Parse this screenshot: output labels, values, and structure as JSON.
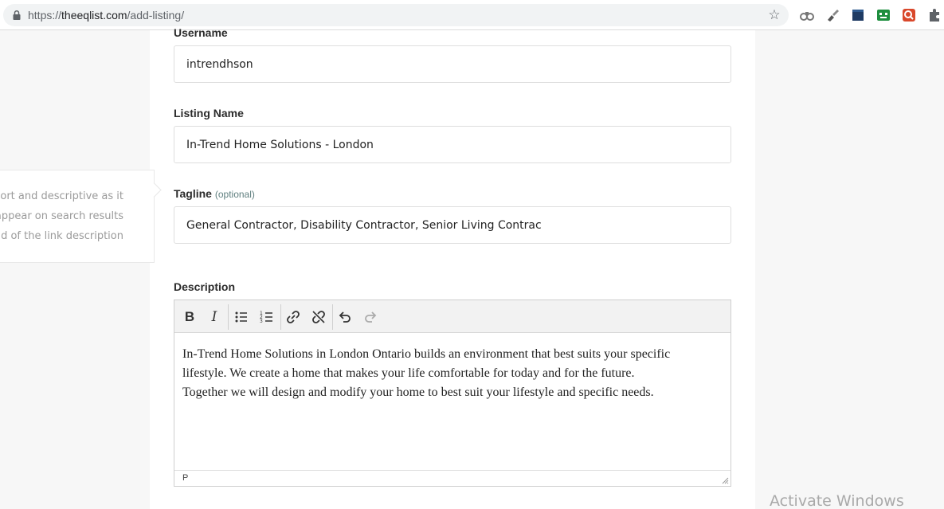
{
  "browser": {
    "url_scheme": "https://",
    "url_host": "theeqlist.com",
    "url_path": "/add-listing/",
    "icons": [
      "lock-icon",
      "bookmark-star-icon",
      "extension-icons",
      "puzzle-icon"
    ]
  },
  "form": {
    "username": {
      "label": "Username",
      "value": "intrendhson"
    },
    "listing_name": {
      "label": "Listing Name",
      "value": "In-Trend Home Solutions - London"
    },
    "tagline": {
      "label": "Tagline",
      "optional": "(optional)",
      "value": "General Contractor, Disability Contractor, Senior Living Contrac"
    },
    "tagline_hint": [
      "it short and descriptive as it",
      "appear on search results",
      "ead of the link description"
    ],
    "description": {
      "label": "Description",
      "lines": [
        "In-Trend Home Solutions in London Ontario builds an environment that best suits your specific",
        "lifestyle. We create a home that makes your life comfortable for today and for the future.",
        "Together we will design and modify your home to best suit your lifestyle and specific needs."
      ],
      "path": "P"
    }
  },
  "toolbar": {
    "bold": "B",
    "italic": "I"
  },
  "overlay": {
    "activate": "Activate Windows"
  },
  "colors": {
    "card": "#ffffff",
    "background": "#f7f7f7"
  }
}
